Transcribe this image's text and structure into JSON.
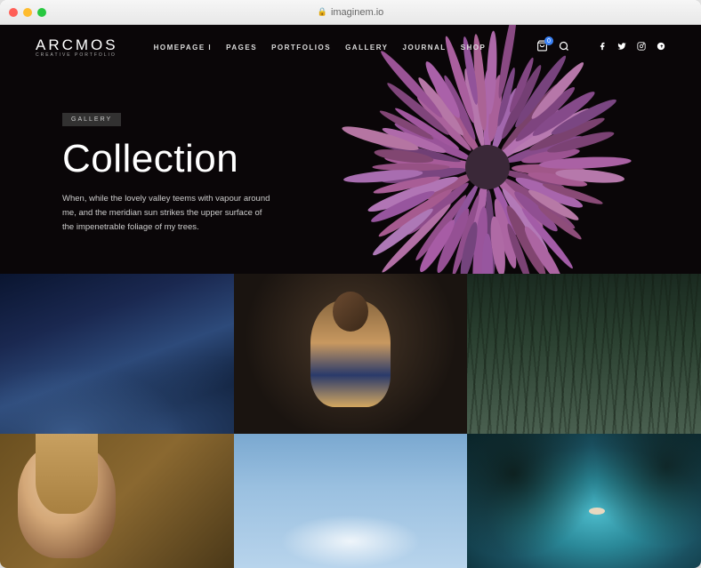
{
  "browser": {
    "url": "imaginem.io"
  },
  "logo": {
    "main": "ARCMOS",
    "sub": "CREATIVE PORTFOLIO"
  },
  "nav": {
    "items": [
      "HOMEPAGE I",
      "PAGES",
      "PORTFOLIOS",
      "GALLERY",
      "JOURNAL",
      "SHOP"
    ]
  },
  "cart": {
    "count": "0"
  },
  "hero": {
    "badge": "GALLERY",
    "title": "Collection",
    "desc": "When, while the lovely valley teems with vapour around me, and the meridian sun strikes the upper surface of the impenetrable foliage of my trees."
  }
}
